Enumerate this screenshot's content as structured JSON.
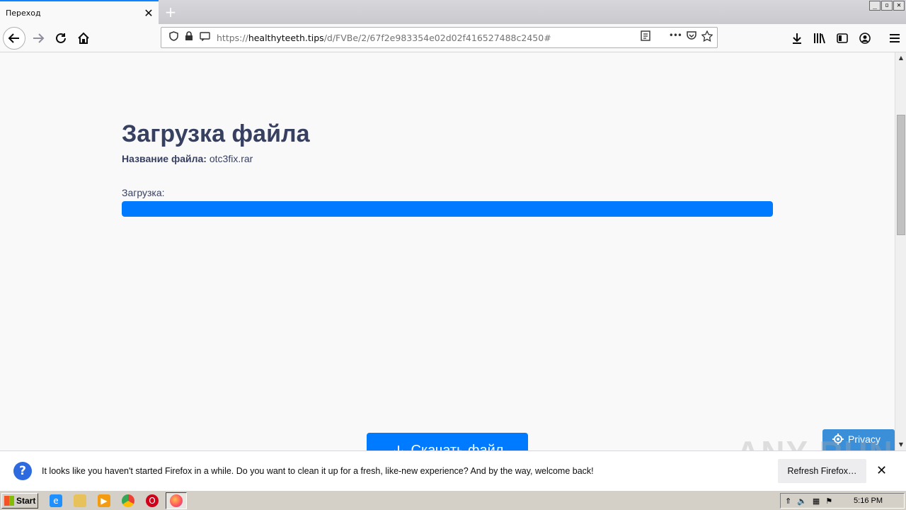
{
  "browser": {
    "tab_title": "Переход",
    "tab_close_glyph": "✕",
    "new_tab_glyph": "+",
    "window_controls": [
      "_",
      "▫",
      "✕"
    ],
    "url_prefix": "https://",
    "url_host": "healthyteeth.tips",
    "url_path": "/d/FVBe/2/67f2e983354e02d02f416527488c2450#",
    "urlbar_more_glyph": "•••"
  },
  "page": {
    "heading": "Загрузка файла",
    "file_label": "Название файла:",
    "file_name": "otc3fix.rar",
    "download_label": "Загрузка:",
    "progress_fraction": 1.0,
    "download_button": "Скачать файл",
    "privacy_button": "Privacy"
  },
  "notification": {
    "message": "It looks like you haven't started Firefox in a while. Do you want to clean it up for a fresh, like-new experience? And by the way, welcome back!",
    "refresh_button": "Refresh Firefox…",
    "close_glyph": "✕"
  },
  "watermark": "ANY RUN",
  "taskbar": {
    "start_label": "Start",
    "clock": "5:16 PM"
  },
  "colors": {
    "accent": "#0a84ff",
    "progress": "#007bff",
    "heading": "#384061"
  }
}
